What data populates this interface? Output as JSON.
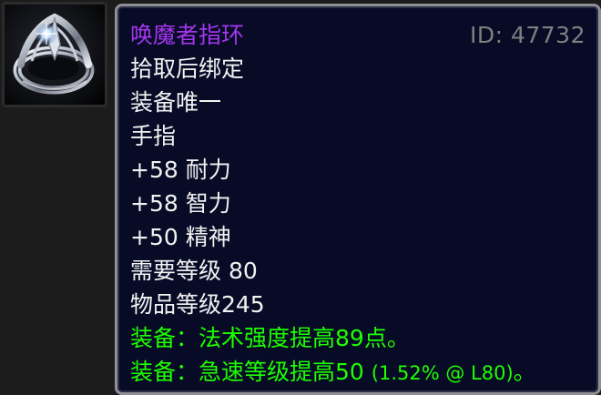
{
  "item": {
    "name": "唤魔者指环",
    "id_label": "ID: 47732",
    "binding": "拾取后绑定",
    "unique": "装备唯一",
    "slot": "手指",
    "stats": [
      "+58 耐力",
      "+58 智力",
      "+50 精神"
    ],
    "required_level": "需要等级 80",
    "item_level": "物品等级245",
    "effects": [
      {
        "prefix": "装备：",
        "text": "法术强度提高89点。"
      },
      {
        "prefix": "装备：",
        "text": "急速等级提高50",
        "detail": "(1.52% @ L80)",
        "suffix": "。"
      }
    ],
    "icon": "silver-ring-icon",
    "colors": {
      "epic": "#a335ee",
      "effect": "#1eff00",
      "id": "#7f7f7f",
      "text": "#f2f2f2",
      "background": "#070b26",
      "border": "#8f8f98"
    }
  }
}
